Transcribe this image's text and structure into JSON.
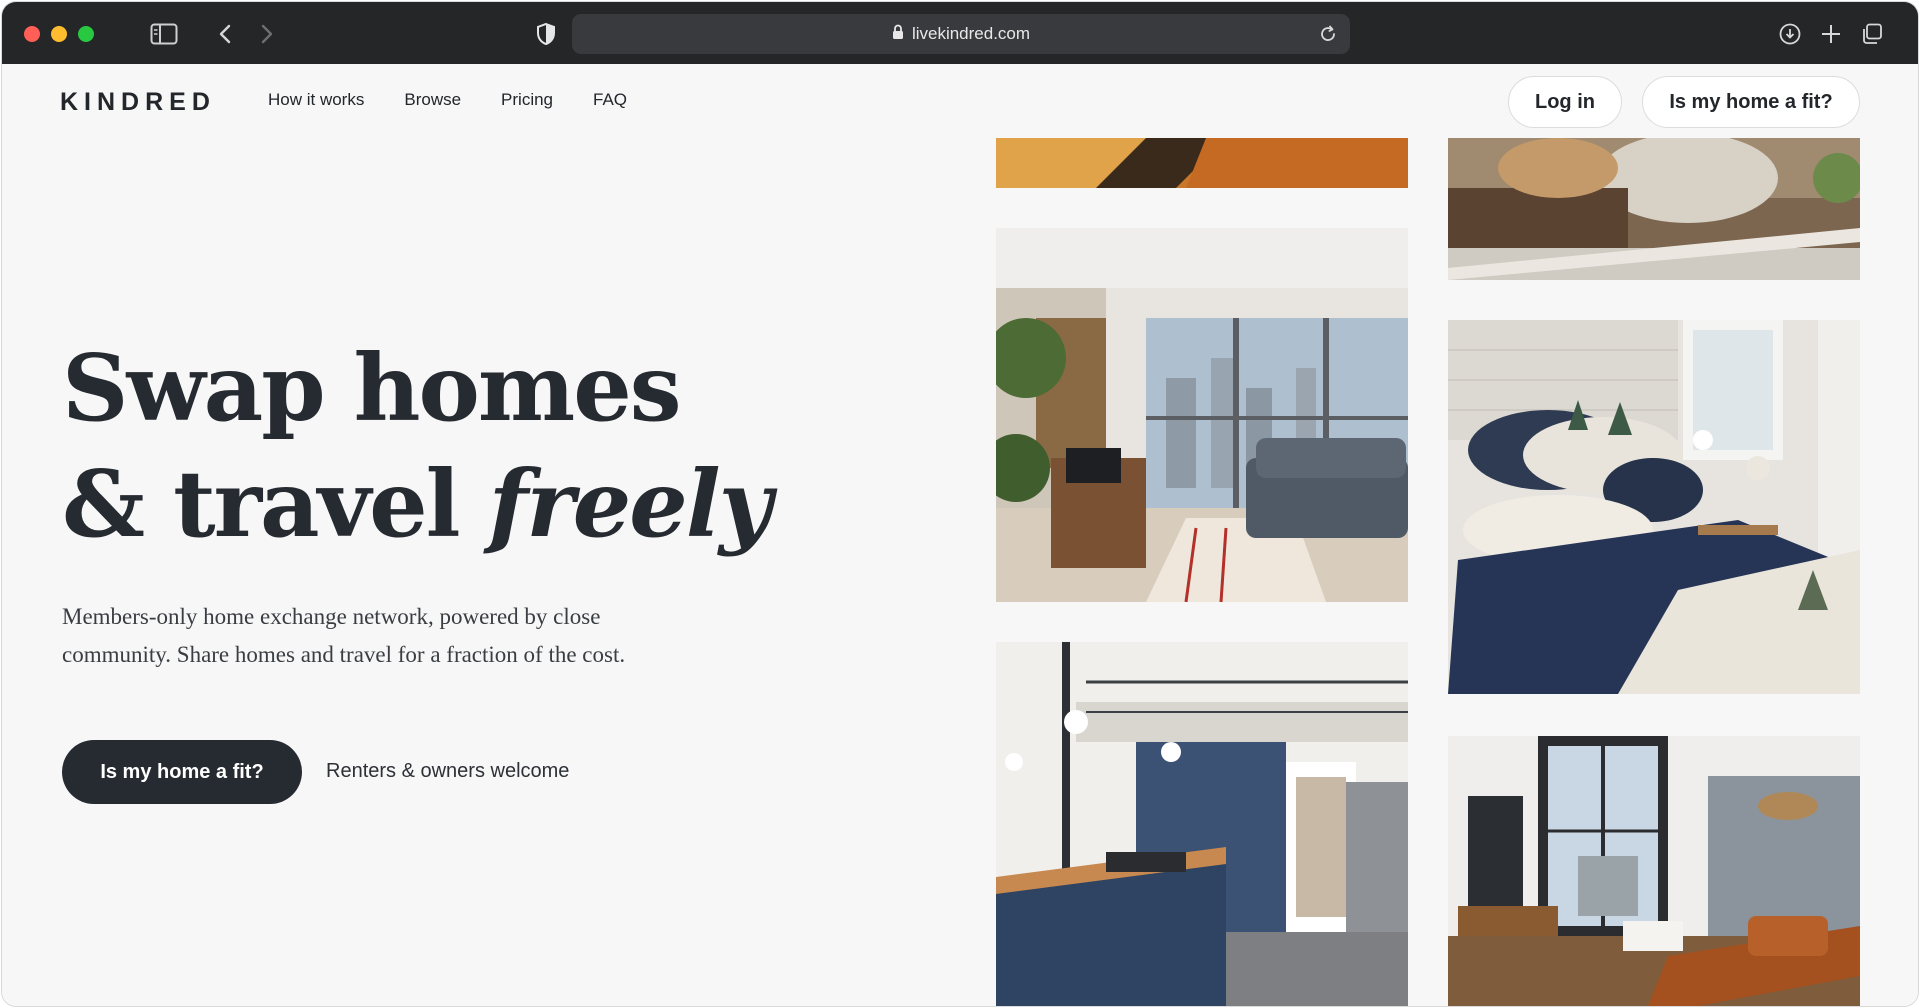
{
  "browser": {
    "url": "livekindred.com"
  },
  "site": {
    "logo": "KINDRED",
    "nav": [
      "How it works",
      "Browse",
      "Pricing",
      "FAQ"
    ],
    "login_label": "Log in",
    "fit_top_label": "Is my home a fit?"
  },
  "hero": {
    "line1": "Swap homes",
    "line2_prefix": "& travel ",
    "line2_em": "freely",
    "subtext": "Members-only home exchange network, powered by close community. Share homes and travel for a fraction of the cost.",
    "cta_label": "Is my home a fit?",
    "cta_note": "Renters & owners welcome"
  },
  "colors": {
    "chrome": "#242628",
    "ink": "#262a31",
    "page_bg": "#f7f7f7"
  }
}
